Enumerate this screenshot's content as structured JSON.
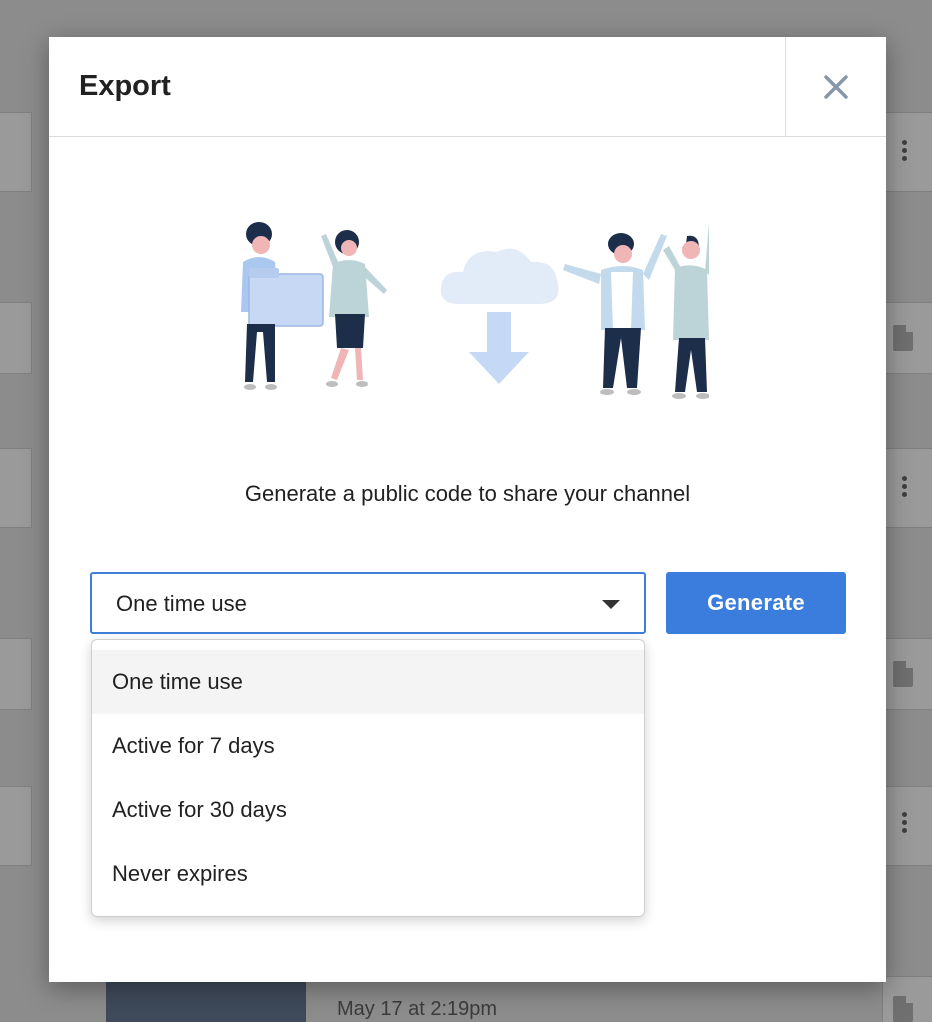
{
  "modal": {
    "title": "Export",
    "subtitle": "Generate a public code to share your channel",
    "generate_label": "Generate"
  },
  "select": {
    "value": "One time use",
    "options": [
      "One time use",
      "Active for 7 days",
      "Active for 30 days",
      "Never expires"
    ]
  },
  "background": {
    "date_text": "May 17 at 2:19pm"
  },
  "colors": {
    "accent": "#3a7ddd",
    "focus_border": "#3f7fd8"
  }
}
